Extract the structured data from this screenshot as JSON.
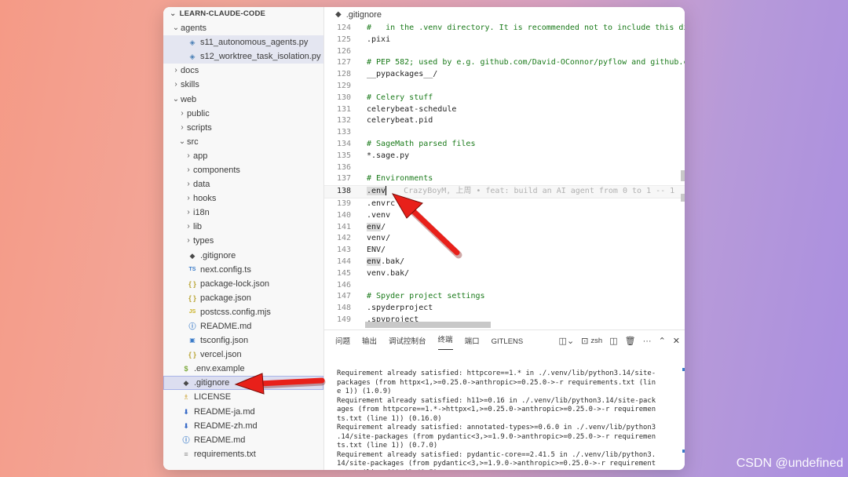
{
  "sidebar": {
    "header": "LEARN-CLAUDE-CODE",
    "items": [
      {
        "label": "agents",
        "chev": "⌄",
        "indent": 1,
        "icon": ""
      },
      {
        "label": "s11_autonomous_agents.py",
        "chev": "",
        "indent": 2,
        "icon": "python-icon"
      },
      {
        "label": "s12_worktree_task_isolation.py",
        "chev": "",
        "indent": 2,
        "icon": "python-icon"
      },
      {
        "label": "docs",
        "chev": "›",
        "indent": 1,
        "icon": ""
      },
      {
        "label": "skills",
        "chev": "›",
        "indent": 1,
        "icon": ""
      },
      {
        "label": "web",
        "chev": "⌄",
        "indent": 1,
        "icon": ""
      },
      {
        "label": "public",
        "chev": "›",
        "indent": 2,
        "icon": ""
      },
      {
        "label": "scripts",
        "chev": "›",
        "indent": 2,
        "icon": ""
      },
      {
        "label": "src",
        "chev": "⌄",
        "indent": 2,
        "icon": ""
      },
      {
        "label": "app",
        "chev": "›",
        "indent": 3,
        "icon": ""
      },
      {
        "label": "components",
        "chev": "›",
        "indent": 3,
        "icon": ""
      },
      {
        "label": "data",
        "chev": "›",
        "indent": 3,
        "icon": ""
      },
      {
        "label": "hooks",
        "chev": "›",
        "indent": 3,
        "icon": ""
      },
      {
        "label": "i18n",
        "chev": "›",
        "indent": 3,
        "icon": ""
      },
      {
        "label": "lib",
        "chev": "›",
        "indent": 3,
        "icon": ""
      },
      {
        "label": "types",
        "chev": "›",
        "indent": 3,
        "icon": ""
      },
      {
        "label": ".gitignore",
        "chev": "",
        "indent": 2,
        "icon": "git-icon"
      },
      {
        "label": "next.config.ts",
        "chev": "",
        "indent": 2,
        "icon": "ts-icon"
      },
      {
        "label": "package-lock.json",
        "chev": "",
        "indent": 2,
        "icon": "json-icon"
      },
      {
        "label": "package.json",
        "chev": "",
        "indent": 2,
        "icon": "json-icon"
      },
      {
        "label": "postcss.config.mjs",
        "chev": "",
        "indent": 2,
        "icon": "js-icon"
      },
      {
        "label": "README.md",
        "chev": "",
        "indent": 2,
        "icon": "info-icon"
      },
      {
        "label": "tsconfig.json",
        "chev": "",
        "indent": 2,
        "icon": "tsconfig-icon"
      },
      {
        "label": "vercel.json",
        "chev": "",
        "indent": 2,
        "icon": "json-icon"
      },
      {
        "label": ".env.example",
        "chev": "",
        "indent": 1,
        "icon": "env-icon"
      },
      {
        "label": ".gitignore",
        "chev": "",
        "indent": 1,
        "icon": "git-icon",
        "active": true
      },
      {
        "label": "LICENSE",
        "chev": "",
        "indent": 1,
        "icon": "license-icon"
      },
      {
        "label": "README-ja.md",
        "chev": "",
        "indent": 1,
        "icon": "markdown-icon"
      },
      {
        "label": "README-zh.md",
        "chev": "",
        "indent": 1,
        "icon": "markdown-icon"
      },
      {
        "label": "README.md",
        "chev": "",
        "indent": 1,
        "icon": "info-icon"
      },
      {
        "label": "requirements.txt",
        "chev": "",
        "indent": 1,
        "icon": "text-icon"
      }
    ]
  },
  "editor": {
    "tab_title": ".gitignore",
    "lines": [
      {
        "n": "124",
        "text": "#   in the .venv directory. It is recommended not to include this di",
        "kind": "comment"
      },
      {
        "n": "125",
        "text": ".pixi",
        "kind": "code"
      },
      {
        "n": "126",
        "text": "",
        "kind": "code"
      },
      {
        "n": "127",
        "text": "# PEP 582; used by e.g. github.com/David-OConnor/pyflow and github.c",
        "kind": "comment"
      },
      {
        "n": "128",
        "text": "__pypackages__/",
        "kind": "code"
      },
      {
        "n": "129",
        "text": "",
        "kind": "code"
      },
      {
        "n": "130",
        "text": "# Celery stuff",
        "kind": "comment"
      },
      {
        "n": "131",
        "text": "celerybeat-schedule",
        "kind": "code"
      },
      {
        "n": "132",
        "text": "celerybeat.pid",
        "kind": "code"
      },
      {
        "n": "133",
        "text": "",
        "kind": "code"
      },
      {
        "n": "134",
        "text": "# SageMath parsed files",
        "kind": "comment"
      },
      {
        "n": "135",
        "text": "*.sage.py",
        "kind": "code"
      },
      {
        "n": "136",
        "text": "",
        "kind": "code"
      },
      {
        "n": "137",
        "text": "# Environments",
        "kind": "comment"
      },
      {
        "n": "138",
        "text": ".env",
        "kind": "current"
      },
      {
        "n": "139",
        "text": ".envrc",
        "kind": "code"
      },
      {
        "n": "140",
        "text": ".venv",
        "kind": "code"
      },
      {
        "n": "141",
        "text": "env/",
        "kind": "hl3"
      },
      {
        "n": "142",
        "text": "venv/",
        "kind": "code"
      },
      {
        "n": "143",
        "text": "ENV/",
        "kind": "code"
      },
      {
        "n": "144",
        "text": "env.bak/",
        "kind": "hl3"
      },
      {
        "n": "145",
        "text": "venv.bak/",
        "kind": "code"
      },
      {
        "n": "146",
        "text": "",
        "kind": "code"
      },
      {
        "n": "147",
        "text": "# Spyder project settings",
        "kind": "comment"
      },
      {
        "n": "148",
        "text": ".spyderproject",
        "kind": "code"
      },
      {
        "n": "149",
        "text": ".spyproject",
        "kind": "code"
      }
    ],
    "blame": "CrazyBoyM, 上周 • feat: build an AI agent from 0 to 1 -- 1"
  },
  "panel": {
    "tabs": [
      "问题",
      "输出",
      "调试控制台",
      "终端",
      "端口",
      "GITLENS"
    ],
    "active_tab": "终端",
    "shell": "zsh",
    "terminal_lines": [
      "Requirement already satisfied: httpcore==1.* in ./.venv/lib/python3.14/site-",
      "packages (from httpx<1,>=0.25.0->anthropic>=0.25.0->-r requirements.txt (lin",
      "e 1)) (1.0.9)",
      "Requirement already satisfied: h11>=0.16 in ./.venv/lib/python3.14/site-pack",
      "ages (from httpcore==1.*->httpx<1,>=0.25.0->anthropic>=0.25.0->-r requiremen",
      "ts.txt (line 1)) (0.16.0)",
      "Requirement already satisfied: annotated-types>=0.6.0 in ./.venv/lib/python3",
      ".14/site-packages (from pydantic<3,>=1.9.0->anthropic>=0.25.0->-r requiremen",
      "ts.txt (line 1)) (0.7.0)",
      "Requirement already satisfied: pydantic-core==2.41.5 in ./.venv/lib/python3.",
      "14/site-packages (from pydantic<3,>=1.9.0->anthropic>=0.25.0->-r requirement",
      "s.txt (line 1)) (2.41.5)"
    ]
  },
  "watermark": "CSDN @undefined",
  "colors": {
    "arrow": "#e8201a",
    "comment": "#1a7a1a",
    "selection": "#dcdef0"
  }
}
